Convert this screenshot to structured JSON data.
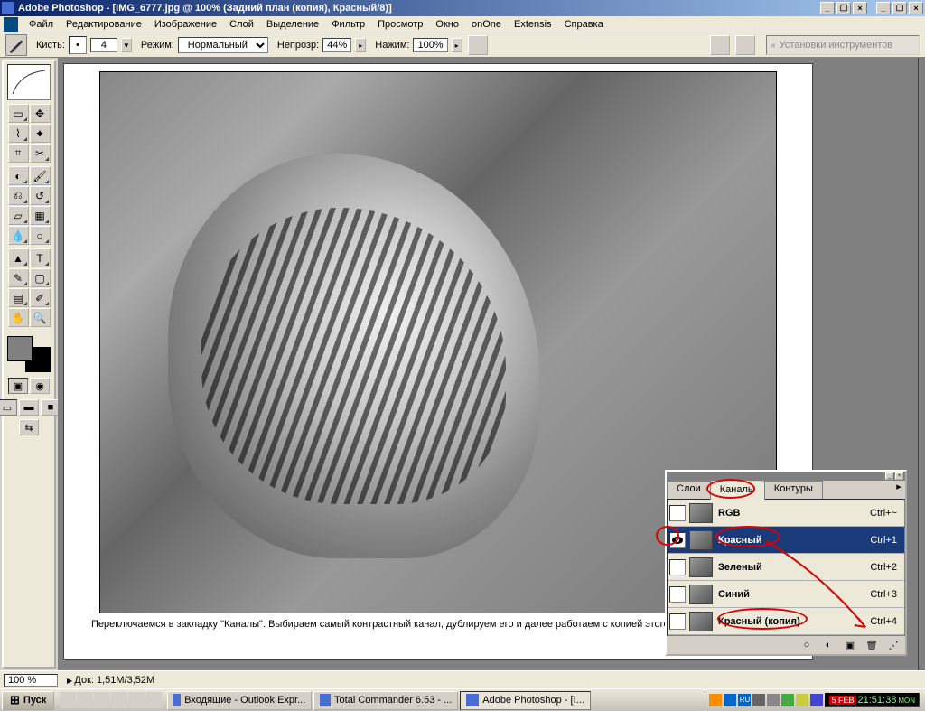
{
  "titlebar": {
    "text": "Adobe Photoshop - [IMG_6777.jpg @ 100% (Задний план (копия), Красный/8)]"
  },
  "menu": {
    "items": [
      "Файл",
      "Редактирование",
      "Изображение",
      "Слой",
      "Выделение",
      "Фильтр",
      "Просмотр",
      "Окно",
      "onOne",
      "Extensis",
      "Справка"
    ]
  },
  "options": {
    "brush_label": "Кисть:",
    "brush_size": "4",
    "mode_label": "Режим:",
    "mode_value": "Нормальный",
    "opacity_label": "Непрозр:",
    "opacity_value": "44%",
    "flow_label": "Нажим:",
    "flow_value": "100%",
    "dock_text": "Установки инструментов"
  },
  "document": {
    "caption": "Переключаемся в закладку \"Каналы\". Выбираем самый контрастный канал, дублируем его и далее работаем с копией этого канала"
  },
  "status": {
    "zoom": "100 %",
    "doc_size": "Док: 1,51M/3,52M"
  },
  "channels_panel": {
    "tabs": [
      "Слои",
      "Каналы",
      "Контуры"
    ],
    "active_tab": 1,
    "rows": [
      {
        "name": "RGB",
        "shortcut": "Ctrl+~",
        "visible": false,
        "selected": false
      },
      {
        "name": "Красный",
        "shortcut": "Ctrl+1",
        "visible": true,
        "selected": true
      },
      {
        "name": "Зеленый",
        "shortcut": "Ctrl+2",
        "visible": false,
        "selected": false
      },
      {
        "name": "Синий",
        "shortcut": "Ctrl+3",
        "visible": false,
        "selected": false
      },
      {
        "name": "Красный (копия)",
        "shortcut": "Ctrl+4",
        "visible": false,
        "selected": false
      }
    ]
  },
  "taskbar": {
    "start": "Пуск",
    "tasks": [
      {
        "label": "Входящие - Outlook Expr...",
        "active": false
      },
      {
        "label": "Total Commander 6.53 - ...",
        "active": false
      },
      {
        "label": "Adobe Photoshop - [I...",
        "active": true
      }
    ],
    "lang": "RU",
    "date": "5 FEB",
    "time": "21:51:38",
    "day": "MON"
  }
}
